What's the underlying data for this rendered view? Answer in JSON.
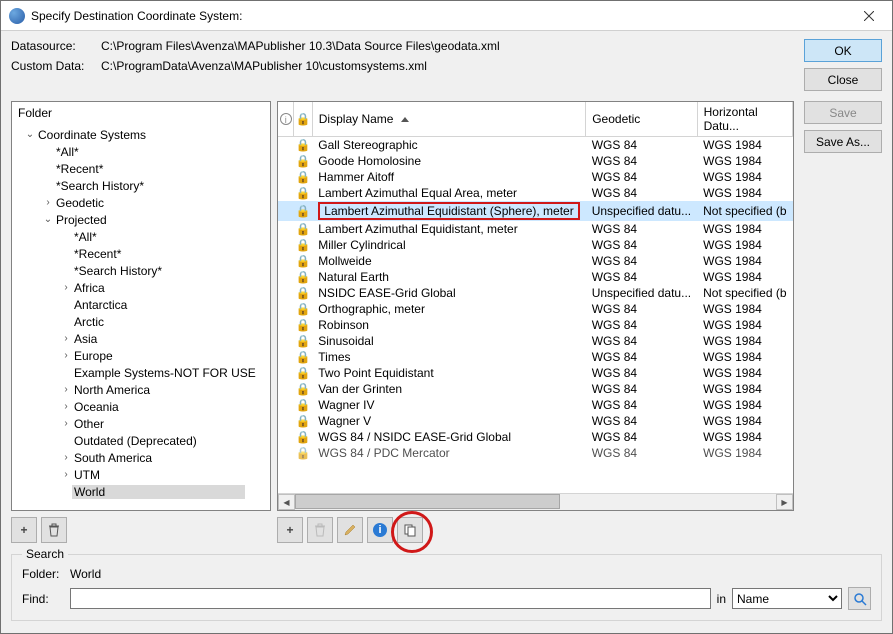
{
  "window": {
    "title": "Specify Destination Coordinate System:"
  },
  "datasource": {
    "label": "Datasource:",
    "value": "C:\\Program Files\\Avenza\\MAPublisher 10.3\\Data Source Files\\geodata.xml"
  },
  "customdata": {
    "label": "Custom Data:",
    "value": "C:\\ProgramData\\Avenza\\MAPublisher 10\\customsystems.xml"
  },
  "buttons": {
    "ok": "OK",
    "close": "Close",
    "save": "Save",
    "saveas": "Save As..."
  },
  "folder": {
    "header": "Folder",
    "items": [
      {
        "label": "Coordinate Systems",
        "indent": 0,
        "twisty": "open"
      },
      {
        "label": "*All*",
        "indent": 1,
        "twisty": "none"
      },
      {
        "label": "*Recent*",
        "indent": 1,
        "twisty": "none"
      },
      {
        "label": "*Search History*",
        "indent": 1,
        "twisty": "none"
      },
      {
        "label": "Geodetic",
        "indent": 1,
        "twisty": "closed"
      },
      {
        "label": "Projected",
        "indent": 1,
        "twisty": "open"
      },
      {
        "label": "*All*",
        "indent": 2,
        "twisty": "none"
      },
      {
        "label": "*Recent*",
        "indent": 2,
        "twisty": "none"
      },
      {
        "label": "*Search History*",
        "indent": 2,
        "twisty": "none"
      },
      {
        "label": "Africa",
        "indent": 2,
        "twisty": "closed"
      },
      {
        "label": "Antarctica",
        "indent": 2,
        "twisty": "none"
      },
      {
        "label": "Arctic",
        "indent": 2,
        "twisty": "none"
      },
      {
        "label": "Asia",
        "indent": 2,
        "twisty": "closed"
      },
      {
        "label": "Europe",
        "indent": 2,
        "twisty": "closed"
      },
      {
        "label": "Example Systems-NOT FOR USE",
        "indent": 2,
        "twisty": "none"
      },
      {
        "label": "North America",
        "indent": 2,
        "twisty": "closed"
      },
      {
        "label": "Oceania",
        "indent": 2,
        "twisty": "closed"
      },
      {
        "label": "Other",
        "indent": 2,
        "twisty": "closed"
      },
      {
        "label": "Outdated (Deprecated)",
        "indent": 2,
        "twisty": "none"
      },
      {
        "label": "South America",
        "indent": 2,
        "twisty": "closed"
      },
      {
        "label": "UTM",
        "indent": 2,
        "twisty": "closed"
      },
      {
        "label": "World",
        "indent": 2,
        "twisty": "none",
        "selected": true
      }
    ]
  },
  "grid": {
    "columns": {
      "c1": "",
      "c2": "",
      "display": "Display Name",
      "geodetic": "Geodetic",
      "hdatum": "Horizontal Datu..."
    },
    "rows": [
      {
        "name": "Gall Stereographic",
        "geo": "WGS 84",
        "hd": "WGS 1984"
      },
      {
        "name": "Goode Homolosine",
        "geo": "WGS 84",
        "hd": "WGS 1984"
      },
      {
        "name": "Hammer Aitoff",
        "geo": "WGS 84",
        "hd": "WGS 1984"
      },
      {
        "name": "Lambert Azimuthal Equal Area, meter",
        "geo": "WGS 84",
        "hd": "WGS 1984"
      },
      {
        "name": "Lambert Azimuthal Equidistant (Sphere), meter",
        "geo": "Unspecified datu...",
        "hd": "Not specified (b",
        "selected": true
      },
      {
        "name": "Lambert Azimuthal Equidistant, meter",
        "geo": "WGS 84",
        "hd": "WGS 1984"
      },
      {
        "name": "Miller Cylindrical",
        "geo": "WGS 84",
        "hd": "WGS 1984"
      },
      {
        "name": "Mollweide",
        "geo": "WGS 84",
        "hd": "WGS 1984"
      },
      {
        "name": "Natural Earth",
        "geo": "WGS 84",
        "hd": "WGS 1984"
      },
      {
        "name": "NSIDC EASE-Grid Global",
        "geo": "Unspecified datu...",
        "hd": "Not specified (b"
      },
      {
        "name": "Orthographic, meter",
        "geo": "WGS 84",
        "hd": "WGS 1984"
      },
      {
        "name": "Robinson",
        "geo": "WGS 84",
        "hd": "WGS 1984"
      },
      {
        "name": "Sinusoidal",
        "geo": "WGS 84",
        "hd": "WGS 1984"
      },
      {
        "name": "Times",
        "geo": "WGS 84",
        "hd": "WGS 1984"
      },
      {
        "name": "Two Point Equidistant",
        "geo": "WGS 84",
        "hd": "WGS 1984"
      },
      {
        "name": "Van der Grinten",
        "geo": "WGS 84",
        "hd": "WGS 1984"
      },
      {
        "name": "Wagner IV",
        "geo": "WGS 84",
        "hd": "WGS 1984"
      },
      {
        "name": "Wagner V",
        "geo": "WGS 84",
        "hd": "WGS 1984"
      },
      {
        "name": "WGS 84 / NSIDC EASE-Grid Global",
        "geo": "WGS 84",
        "hd": "WGS 1984"
      },
      {
        "name": "WGS 84 / PDC Mercator",
        "geo": "WGS 84",
        "hd": "WGS 1984",
        "cut": true
      }
    ]
  },
  "folder_icons": {
    "add": "+",
    "delete": "trash"
  },
  "grid_icons": {
    "add": "+",
    "delete": "trash",
    "edit": "pencil",
    "info": "info",
    "copy": "copy"
  },
  "search": {
    "legend": "Search",
    "folder_label": "Folder:",
    "folder_value": "World",
    "find_label": "Find:",
    "find_value": "",
    "in_label": "in",
    "by_value": "Name",
    "go": "search"
  }
}
